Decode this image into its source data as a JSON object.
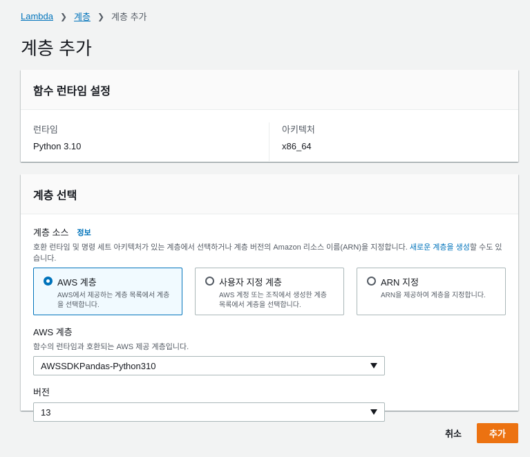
{
  "breadcrumb": {
    "items": [
      "Lambda",
      "계층"
    ],
    "current": "계층 추가"
  },
  "page": {
    "title": "계층 추가"
  },
  "runtime_panel": {
    "title": "함수 런타임 설정",
    "runtime_label": "런타임",
    "runtime_value": "Python 3.10",
    "arch_label": "아키텍처",
    "arch_value": "x86_64"
  },
  "layer_panel": {
    "title": "계층 선택",
    "source_label": "계층 소스",
    "info": "정보",
    "source_desc_prefix": "호환 런타임 및 명령 세트 아키텍처가 있는 계층에서 선택하거나 계층 버전의 Amazon 리소스 이름(ARN)을 지정합니다. ",
    "source_desc_link": "새로운 계층을 생성",
    "source_desc_suffix": "할 수도 있습니다.",
    "options": [
      {
        "title": "AWS 계층",
        "desc": "AWS에서 제공하는 계층 목록에서 계층을 선택합니다.",
        "selected": true
      },
      {
        "title": "사용자 지정 계층",
        "desc": "AWS 계정 또는 조직에서 생성한 계층 목록에서 계층을 선택합니다.",
        "selected": false
      },
      {
        "title": "ARN 지정",
        "desc": "ARN을 제공하여 계층을 지정합니다.",
        "selected": false
      }
    ],
    "aws_layer_label": "AWS 계층",
    "aws_layer_desc": "함수의 런타임과 호환되는 AWS 제공 계층입니다.",
    "aws_layer_value": "AWSSDKPandas-Python310",
    "version_label": "버전",
    "version_value": "13"
  },
  "footer": {
    "cancel": "취소",
    "add": "추가"
  },
  "colors": {
    "accent": "#0073bb",
    "primary_button": "#ec7211"
  }
}
